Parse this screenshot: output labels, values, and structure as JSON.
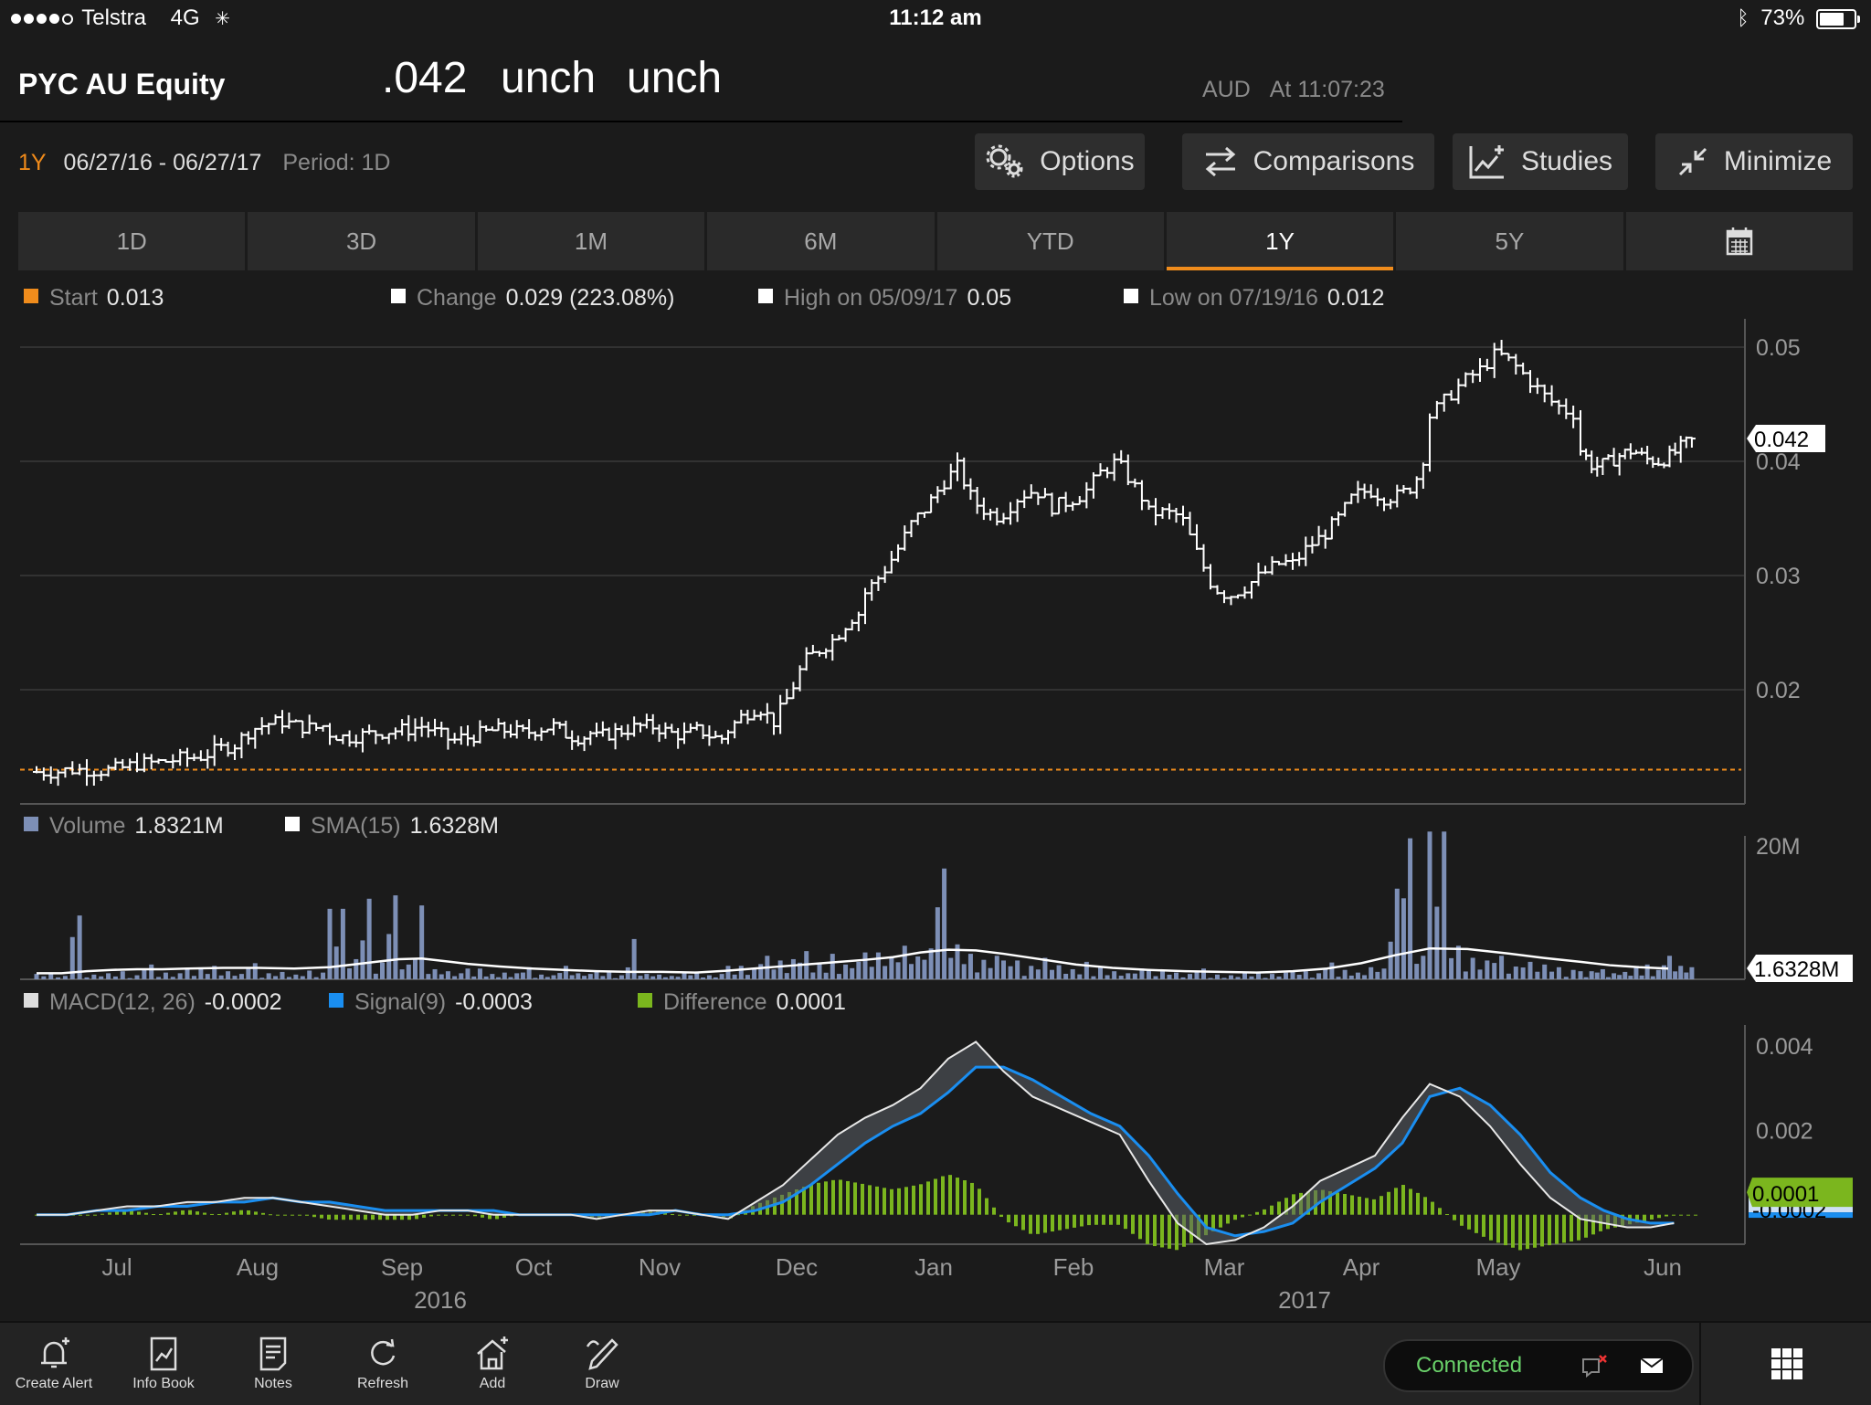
{
  "status_bar": {
    "carrier": "Telstra",
    "network": "4G",
    "time": "11:12 am",
    "battery": "73%",
    "battery_level": 0.73
  },
  "header": {
    "ticker": "PYC AU Equity",
    "last": ".042",
    "change": "unch",
    "change_pct": "unch",
    "currency": "AUD",
    "as_of": "At 11:07:23"
  },
  "range": {
    "selected": "1Y",
    "dates": "06/27/16 - 06/27/17",
    "period": "Period: 1D"
  },
  "buttons": {
    "options": "Options",
    "comparisons": "Comparisons",
    "studies": "Studies",
    "minimize": "Minimize"
  },
  "tabs": [
    "1D",
    "3D",
    "1M",
    "6M",
    "YTD",
    "1Y",
    "5Y"
  ],
  "price_legend": {
    "start_label": "Start",
    "start_value": "0.013",
    "change_label": "Change",
    "change_value": "0.029 (223.08%)",
    "high_label": "High on 05/09/17",
    "high_value": "0.05",
    "low_label": "Low on 07/19/16",
    "low_value": "0.012"
  },
  "volume_legend": {
    "volume_label": "Volume",
    "volume_value": "1.8321M",
    "sma_label": "SMA(15)",
    "sma_value": "1.6328M"
  },
  "macd_legend": {
    "macd_label": "MACD(12, 26)",
    "macd_value": "-0.0002",
    "signal_label": "Signal(9)",
    "signal_value": "-0.0003",
    "diff_label": "Difference",
    "diff_value": "0.0001"
  },
  "colors": {
    "accent": "#f08c1c",
    "volume": "#7d8fb6",
    "signal": "#1a8ef0",
    "difference": "#7bb61e",
    "connected": "#6ad26a"
  },
  "toolbar": {
    "create_alert": "Create Alert",
    "info_book": "Info Book",
    "notes": "Notes",
    "refresh": "Refresh",
    "add": "Add",
    "draw": "Draw",
    "connected": "Connected"
  },
  "chart_data": [
    {
      "type": "bar",
      "subtype": "ohlc",
      "ylim": [
        0.01,
        0.052
      ],
      "yticks": [
        "0.05",
        "0.04",
        "0.03",
        "0.02"
      ],
      "last_value_label": "0.042",
      "start_level": 0.013,
      "x_month_labels": [
        "Jul",
        "Aug",
        "Sep",
        "Oct",
        "Nov",
        "Dec",
        "Jan",
        "Feb",
        "Mar",
        "Apr",
        "May",
        "Jun"
      ],
      "x_year_labels": [
        "2016",
        "2017"
      ],
      "closes_by_month": [
        {
          "x": "Jul",
          "values": [
            0.0128,
            0.0128,
            0.013,
            0.013,
            0.0129,
            0.0131,
            0.0135,
            0.0136,
            0.0138,
            0.0141
          ]
        },
        {
          "x": "Aug",
          "values": [
            0.014,
            0.0142,
            0.0148,
            0.0152,
            0.0165,
            0.017,
            0.0172,
            0.0168,
            0.0166,
            0.017
          ]
        },
        {
          "x": "Sep",
          "values": [
            0.0162,
            0.0158,
            0.016,
            0.0162,
            0.0164,
            0.0165,
            0.0168,
            0.0162,
            0.0155,
            0.016
          ]
        },
        {
          "x": "Oct",
          "values": [
            0.0158,
            0.0162,
            0.0165,
            0.0164,
            0.0162,
            0.0166,
            0.0168,
            0.016,
            0.0158,
            0.0165
          ]
        },
        {
          "x": "Nov",
          "values": [
            0.0158,
            0.0162,
            0.0165,
            0.0168,
            0.0168,
            0.0162,
            0.016,
            0.0165,
            0.0158,
            0.0157
          ]
        },
        {
          "x": "Dec",
          "values": [
            0.0165,
            0.0178,
            0.0185,
            0.0172,
            0.0195,
            0.0225,
            0.0235,
            0.0245,
            0.0262,
            0.027
          ]
        },
        {
          "x": "Jan",
          "values": [
            0.0285,
            0.03,
            0.032,
            0.0345,
            0.036,
            0.038,
            0.0395,
            0.0365,
            0.0355,
            0.035
          ]
        },
        {
          "x": "Feb",
          "values": [
            0.0355,
            0.037,
            0.0375,
            0.036,
            0.0365,
            0.0372,
            0.039,
            0.04,
            0.038,
            0.036
          ]
        },
        {
          "x": "Mar",
          "values": [
            0.0355,
            0.0355,
            0.0352,
            0.032,
            0.029,
            0.0282,
            0.029,
            0.03,
            0.031,
            0.0312
          ]
        },
        {
          "x": "Apr",
          "values": [
            0.031,
            0.0325,
            0.0335,
            0.035,
            0.037,
            0.0375,
            0.0368,
            0.037,
            0.038,
            0.042
          ]
        },
        {
          "x": "May",
          "values": [
            0.044,
            0.0455,
            0.047,
            0.048,
            0.0495,
            0.0485,
            0.047,
            0.0455,
            0.0445,
            0.044
          ]
        },
        {
          "x": "Jun",
          "values": [
            0.041,
            0.0395,
            0.0398,
            0.0405,
            0.041,
            0.0402,
            0.04,
            0.0405,
            0.0415,
            0.042
          ]
        }
      ]
    },
    {
      "type": "bar",
      "ylim": [
        0,
        20000000
      ],
      "yticks": [
        "20M"
      ],
      "last_value_label": "1.6328M",
      "series": [
        {
          "name": "Volume",
          "values_millions_by_month": {
            "Jul": [
              0.8,
              0.5,
              9.5,
              0.7,
              0.9,
              1.2,
              0.6,
              2.2,
              1.0,
              0.9
            ],
            "Aug": [
              1.5,
              2.0,
              1.2,
              0.8,
              2.4,
              0.9,
              1.1,
              0.7,
              1.3,
              1.0
            ],
            "Sep": [
              10.5,
              3.0,
              12.0,
              2.5,
              12.5,
              2.2,
              11.0,
              1.5,
              1.2,
              0.9
            ],
            "Oct": [
              1.6,
              0.8,
              1.0,
              0.9,
              1.8,
              0.7,
              0.6,
              2.0,
              0.9,
              0.8
            ],
            "Nov": [
              1.1,
              0.6,
              6.0,
              0.8,
              0.7,
              0.5,
              0.9,
              1.0,
              0.6,
              0.8
            ],
            "Dec": [
              2.0,
              1.5,
              3.5,
              2.8,
              3.0,
              4.2,
              2.5,
              3.8,
              2.2,
              2.6
            ],
            "Jan": [
              4.0,
              3.2,
              5.0,
              3.4,
              4.6,
              16.5,
              5.2,
              3.8,
              2.9,
              3.5
            ],
            "Feb": [
              2.8,
              2.0,
              3.2,
              2.1,
              1.5,
              2.6,
              1.8,
              1.2,
              0.9,
              1.6
            ],
            "Mar": [
              1.4,
              1.0,
              0.8,
              1.6,
              0.7,
              0.6,
              1.1,
              0.9,
              0.8,
              1.0
            ],
            "Apr": [
              1.2,
              0.9,
              2.5,
              1.4,
              1.0,
              1.8,
              1.6,
              13.5,
              21.0,
              3.5
            ],
            "May": [
              22.0,
              5.0,
              3.2,
              2.8,
              3.5,
              1.9,
              2.6,
              2.2,
              1.8,
              1.4
            ],
            "Jun": [
              1.2,
              1.5,
              0.9,
              1.1,
              1.8,
              2.2,
              1.4,
              3.5,
              2.0,
              1.8
            ]
          }
        },
        {
          "name": "SMA(15)",
          "values_millions_by_month": {
            "Jul": [
              0.9,
              0.9,
              1.2,
              1.4,
              1.5,
              1.5
            ],
            "Aug": [
              1.6,
              1.7,
              1.7,
              1.6
            ],
            "Sep": [
              1.8,
              2.2,
              2.6,
              3.0,
              3.1,
              2.7
            ],
            "Oct": [
              2.3,
              1.9,
              1.6,
              1.4
            ],
            "Nov": [
              1.2,
              1.1,
              1.1,
              1.0
            ],
            "Dec": [
              1.3,
              1.7,
              2.1,
              2.5
            ],
            "Jan": [
              2.9,
              3.3,
              4.0,
              4.4,
              4.3
            ],
            "Feb": [
              3.8,
              3.0,
              2.2,
              1.7
            ],
            "Mar": [
              1.4,
              1.2,
              1.1,
              1.0
            ],
            "Apr": [
              1.2,
              1.6,
              2.4,
              3.6
            ],
            "May": [
              4.6,
              4.5,
              3.9,
              3.2
            ],
            "Jun": [
              2.6,
              2.1,
              1.8,
              1.6
            ]
          }
        }
      ]
    },
    {
      "type": "line",
      "ylim": [
        -0.0007,
        0.0045
      ],
      "yticks": [
        "0.004",
        "0.002"
      ],
      "last_value_label": "0.0001",
      "last_signal_label": "-0.0002",
      "series": [
        {
          "name": "MACD(12, 26)",
          "values_by_month": {
            "Jul": [
              0.0,
              0.0,
              0.0001,
              0.0002,
              0.0002
            ],
            "Aug": [
              0.0003,
              0.0003,
              0.0004,
              0.0004,
              0.0003
            ],
            "Sep": [
              0.0002,
              0.0001,
              0.0,
              0.0,
              0.0001
            ],
            "Oct": [
              0.0001,
              0.0,
              0.0,
              0.0,
              0.0
            ],
            "Nov": [
              -0.0001,
              0.0,
              0.0001,
              0.0001,
              0.0
            ],
            "Dec": [
              -0.0001,
              0.0003,
              0.0007,
              0.0013,
              0.0019
            ],
            "Jan": [
              0.0023,
              0.0026,
              0.003,
              0.0037,
              0.0041
            ],
            "Feb": [
              0.0034,
              0.0028,
              0.0025,
              0.0022,
              0.0019
            ],
            "Mar": [
              0.0008,
              -0.0002,
              -0.0007,
              -0.0006,
              -0.0003
            ],
            "Apr": [
              0.0002,
              0.0008,
              0.0011,
              0.0014,
              0.0023
            ],
            "May": [
              0.0031,
              0.0028,
              0.0021,
              0.0012,
              0.0004
            ],
            "Jun": [
              -0.0001,
              -0.0002,
              -0.0003,
              -0.0003,
              -0.0002
            ]
          }
        },
        {
          "name": "Signal(9)",
          "values_by_month": {
            "Jul": [
              0.0,
              0.0,
              0.0001,
              0.0001,
              0.0002
            ],
            "Aug": [
              0.0002,
              0.0003,
              0.0003,
              0.0004,
              0.0003
            ],
            "Sep": [
              0.0003,
              0.0002,
              0.0001,
              0.0001,
              0.0001
            ],
            "Oct": [
              0.0001,
              0.0001,
              0.0,
              0.0,
              0.0
            ],
            "Nov": [
              0.0,
              0.0,
              0.0,
              0.0001,
              0.0
            ],
            "Dec": [
              0.0,
              0.0001,
              0.0003,
              0.0007,
              0.0012
            ],
            "Jan": [
              0.0017,
              0.0021,
              0.0024,
              0.0029,
              0.0035
            ],
            "Feb": [
              0.0035,
              0.0032,
              0.0028,
              0.0024,
              0.0021
            ],
            "Mar": [
              0.0014,
              0.0005,
              -0.0003,
              -0.0005,
              -0.0004
            ],
            "Apr": [
              -0.0002,
              0.0003,
              0.0007,
              0.0011,
              0.0017
            ],
            "May": [
              0.0028,
              0.003,
              0.0026,
              0.0019,
              0.001
            ],
            "Jun": [
              0.0004,
              0.0001,
              -0.0001,
              -0.0002,
              -0.0002
            ]
          }
        },
        {
          "name": "Difference",
          "note_values_are_macd_minus_signal": true
        }
      ]
    }
  ]
}
